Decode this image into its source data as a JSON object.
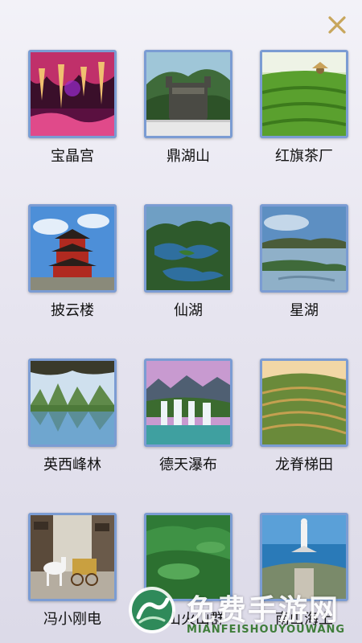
{
  "close": {
    "icon": "close-x-icon",
    "color": "#c8a65c"
  },
  "items": [
    {
      "label": "宝晶宫"
    },
    {
      "label": "鼎湖山"
    },
    {
      "label": "红旗茶厂"
    },
    {
      "label": "披云楼"
    },
    {
      "label": "仙湖"
    },
    {
      "label": "星湖"
    },
    {
      "label": "英西峰林"
    },
    {
      "label": "德天瀑布"
    },
    {
      "label": "龙脊梯田"
    },
    {
      "label": "冯小刚电"
    },
    {
      "label": "西山火山群"
    },
    {
      "label": "南山海上"
    }
  ],
  "watermark": {
    "title": "免费手游网",
    "subtitle": "MIANFEISHOUYOUWANG"
  }
}
